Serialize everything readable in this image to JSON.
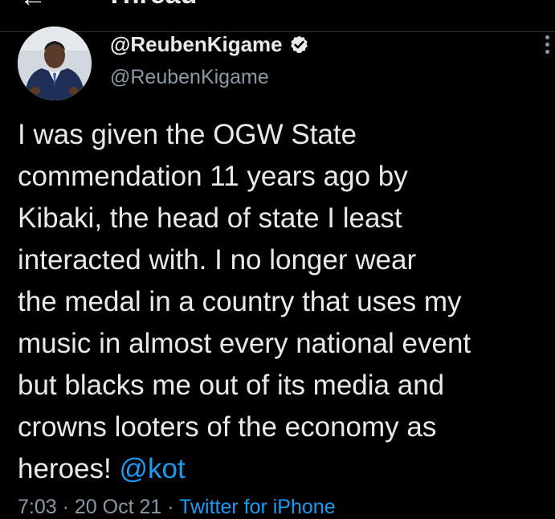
{
  "header": {
    "title": "Thread",
    "back_icon": "arrow-left-icon"
  },
  "tweet": {
    "display_name": "@ReubenKigame",
    "handle": "@ReubenKigame",
    "verified_icon": "verified-badge-icon",
    "more_icon": "more-vertical-icon",
    "text_lines": [
      "I was given the OGW State",
      "commendation 11 years ago by",
      "Kibaki, the head of state I least",
      "interacted with. I no longer wear",
      "the medal in a country that uses my",
      "music in almost every national event",
      "but blacks me out of its media and",
      "crowns looters of the economy as",
      "heroes! "
    ],
    "mention": "@kot",
    "time": "7:03",
    "separator": " · ",
    "date": "20 Oct 21",
    "source": "Twitter for iPhone"
  },
  "colors": {
    "background": "#000000",
    "text": "#e7e9ea",
    "secondary": "#8b98a5",
    "link": "#1d9bf0",
    "divider": "#2f3336"
  }
}
